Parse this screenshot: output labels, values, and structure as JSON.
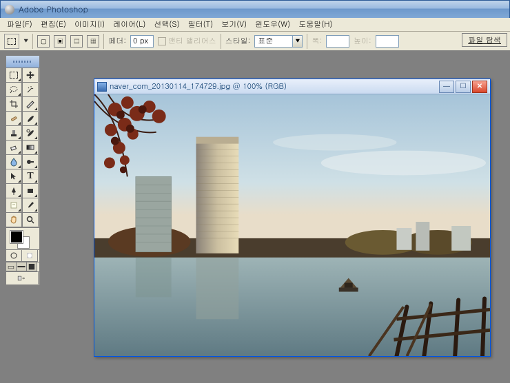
{
  "title": "Adobe Photoshop",
  "menu": {
    "file": "파일(F)",
    "edit": "편집(E)",
    "image": "이미지(I)",
    "layer": "레이어(L)",
    "select": "선택(S)",
    "filter": "필터(T)",
    "view": "보기(V)",
    "window": "윈도우(W)",
    "help": "도움말(H)"
  },
  "options": {
    "feather_label": "페더:",
    "feather_value": "0 px",
    "anti_alias": "앤티 앨리어스",
    "style_label": "스타일:",
    "style_value": "표준",
    "width_label": "폭:",
    "width_value": "",
    "height_label": "높이:",
    "height_value": "",
    "file_explorer": "파일 탐색"
  },
  "document": {
    "title": "naver_com_20130114_174729.jpg @ 100% (RGB)"
  },
  "tools": [
    [
      "marquee",
      "move"
    ],
    [
      "lasso",
      "wand"
    ],
    [
      "crop",
      "slice"
    ],
    [
      "heal",
      "brush"
    ],
    [
      "stamp",
      "history-brush"
    ],
    [
      "eraser",
      "gradient"
    ],
    [
      "blur",
      "dodge"
    ],
    [
      "path",
      "type"
    ],
    [
      "pen",
      "shape"
    ],
    [
      "notes",
      "eyedropper"
    ],
    [
      "hand",
      "zoom"
    ]
  ]
}
